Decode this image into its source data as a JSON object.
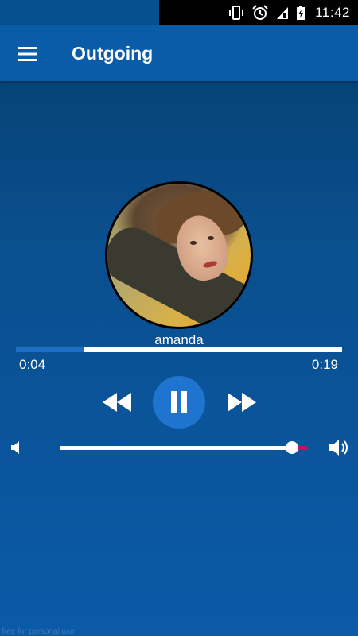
{
  "status_bar": {
    "time": "11:42",
    "icons": [
      "vibrate-icon",
      "alarm-icon",
      "signal-icon",
      "battery-icon"
    ]
  },
  "app_bar": {
    "title": "Outgoing",
    "menu_icon": "hamburger-menu-icon"
  },
  "contact": {
    "name": "amanda"
  },
  "playback": {
    "elapsed": "0:04",
    "total": "0:19",
    "progress_fraction": 0.21
  },
  "controls": {
    "rewind_icon": "rewind-icon",
    "pause_icon": "pause-icon",
    "forward_icon": "fast-forward-icon"
  },
  "volume": {
    "level_fraction": 0.94,
    "low_icon": "volume-low-icon",
    "high_icon": "volume-high-icon"
  },
  "footer": {
    "note": "free for personal use"
  },
  "colors": {
    "app_bar": "#0a5ba8",
    "background_top": "#053d6c",
    "background_bottom": "#0b5aa8",
    "accent": "#1f74cf",
    "volume_rest": "#c0145c"
  }
}
